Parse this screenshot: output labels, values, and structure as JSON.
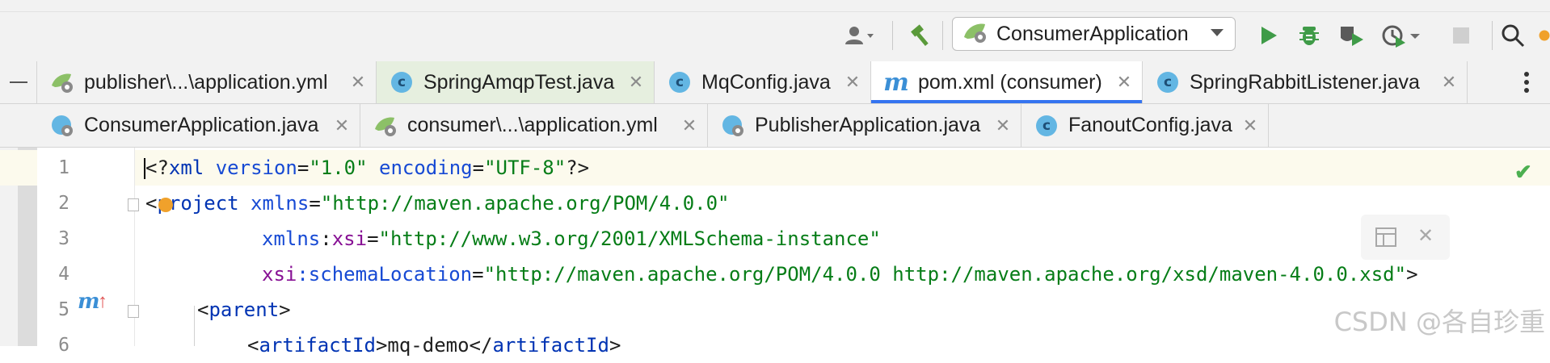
{
  "toolbar": {
    "run_config_label": "ConsumerApplication",
    "icons": [
      "user-icon",
      "build-hammer-icon",
      "run-icon",
      "debug-icon",
      "coverage-icon",
      "profile-icon",
      "stop-icon",
      "search-icon"
    ]
  },
  "tabs_row1": [
    {
      "label": "publisher\\...\\application.yml",
      "icon": "spring-yml"
    },
    {
      "label": "SpringAmqpTest.java",
      "icon": "class-c"
    },
    {
      "label": "MqConfig.java",
      "icon": "class-c"
    },
    {
      "label": "pom.xml (consumer)",
      "icon": "maven-m"
    },
    {
      "label": "SpringRabbitListener.java",
      "icon": "class-c"
    }
  ],
  "tabs_row2": [
    {
      "label": "ConsumerApplication.java",
      "icon": "spring-class"
    },
    {
      "label": "consumer\\...\\application.yml",
      "icon": "spring-yml"
    },
    {
      "label": "PublisherApplication.java",
      "icon": "spring-class"
    },
    {
      "label": "FanoutConfig.java",
      "icon": "class-c"
    }
  ],
  "editor": {
    "line_numbers": [
      "1",
      "2",
      "3",
      "4",
      "5",
      "6"
    ],
    "lines": [
      [
        {
          "t": "<?",
          "c": "punc"
        },
        {
          "t": "xml",
          "c": "tag"
        },
        {
          "t": " version",
          "c": "attr"
        },
        {
          "t": "=",
          "c": "punc"
        },
        {
          "t": "\"1.0\"",
          "c": "val"
        },
        {
          "t": " encoding",
          "c": "attr"
        },
        {
          "t": "=",
          "c": "punc"
        },
        {
          "t": "\"UTF-8\"",
          "c": "val"
        },
        {
          "t": "?>",
          "c": "punc"
        }
      ],
      [
        {
          "t": "<",
          "c": "punc"
        },
        {
          "t": "project",
          "c": "tag"
        },
        {
          "t": " xmlns",
          "c": "attr"
        },
        {
          "t": "=",
          "c": "punc"
        },
        {
          "t": "\"http://maven.apache.org/POM/4.0.0\"",
          "c": "val"
        }
      ],
      [
        {
          "t": "xmlns",
          "c": "attr"
        },
        {
          "t": ":",
          "c": "punc"
        },
        {
          "t": "xsi",
          "c": "ns"
        },
        {
          "t": "=",
          "c": "punc"
        },
        {
          "t": "\"http://www.w3.org/2001/XMLSchema-instance\"",
          "c": "val"
        }
      ],
      [
        {
          "t": "xsi",
          "c": "ns"
        },
        {
          "t": ":schemaLocation",
          "c": "attr"
        },
        {
          "t": "=",
          "c": "punc"
        },
        {
          "t": "\"http://maven.apache.org/POM/4.0.0 http://maven.apache.org/xsd/maven-4.0.0.xsd\"",
          "c": "val"
        },
        {
          "t": ">",
          "c": "punc"
        }
      ],
      [
        {
          "t": "<",
          "c": "punc"
        },
        {
          "t": "parent",
          "c": "tag"
        },
        {
          "t": ">",
          "c": "punc"
        }
      ],
      [
        {
          "t": "<",
          "c": "punc"
        },
        {
          "t": "artifactId",
          "c": "tag"
        },
        {
          "t": ">mq-demo</",
          "c": "punc"
        },
        {
          "t": "artifactId",
          "c": "tag"
        },
        {
          "t": ">",
          "c": "punc"
        }
      ]
    ],
    "gutter_marker": "m↑"
  },
  "watermark": "CSDN @各自珍重",
  "colors": {
    "selected_tab_underline": "#3574f0",
    "current_line": "#fcfaed",
    "string": "#067d17",
    "tag": "#0033b3"
  }
}
